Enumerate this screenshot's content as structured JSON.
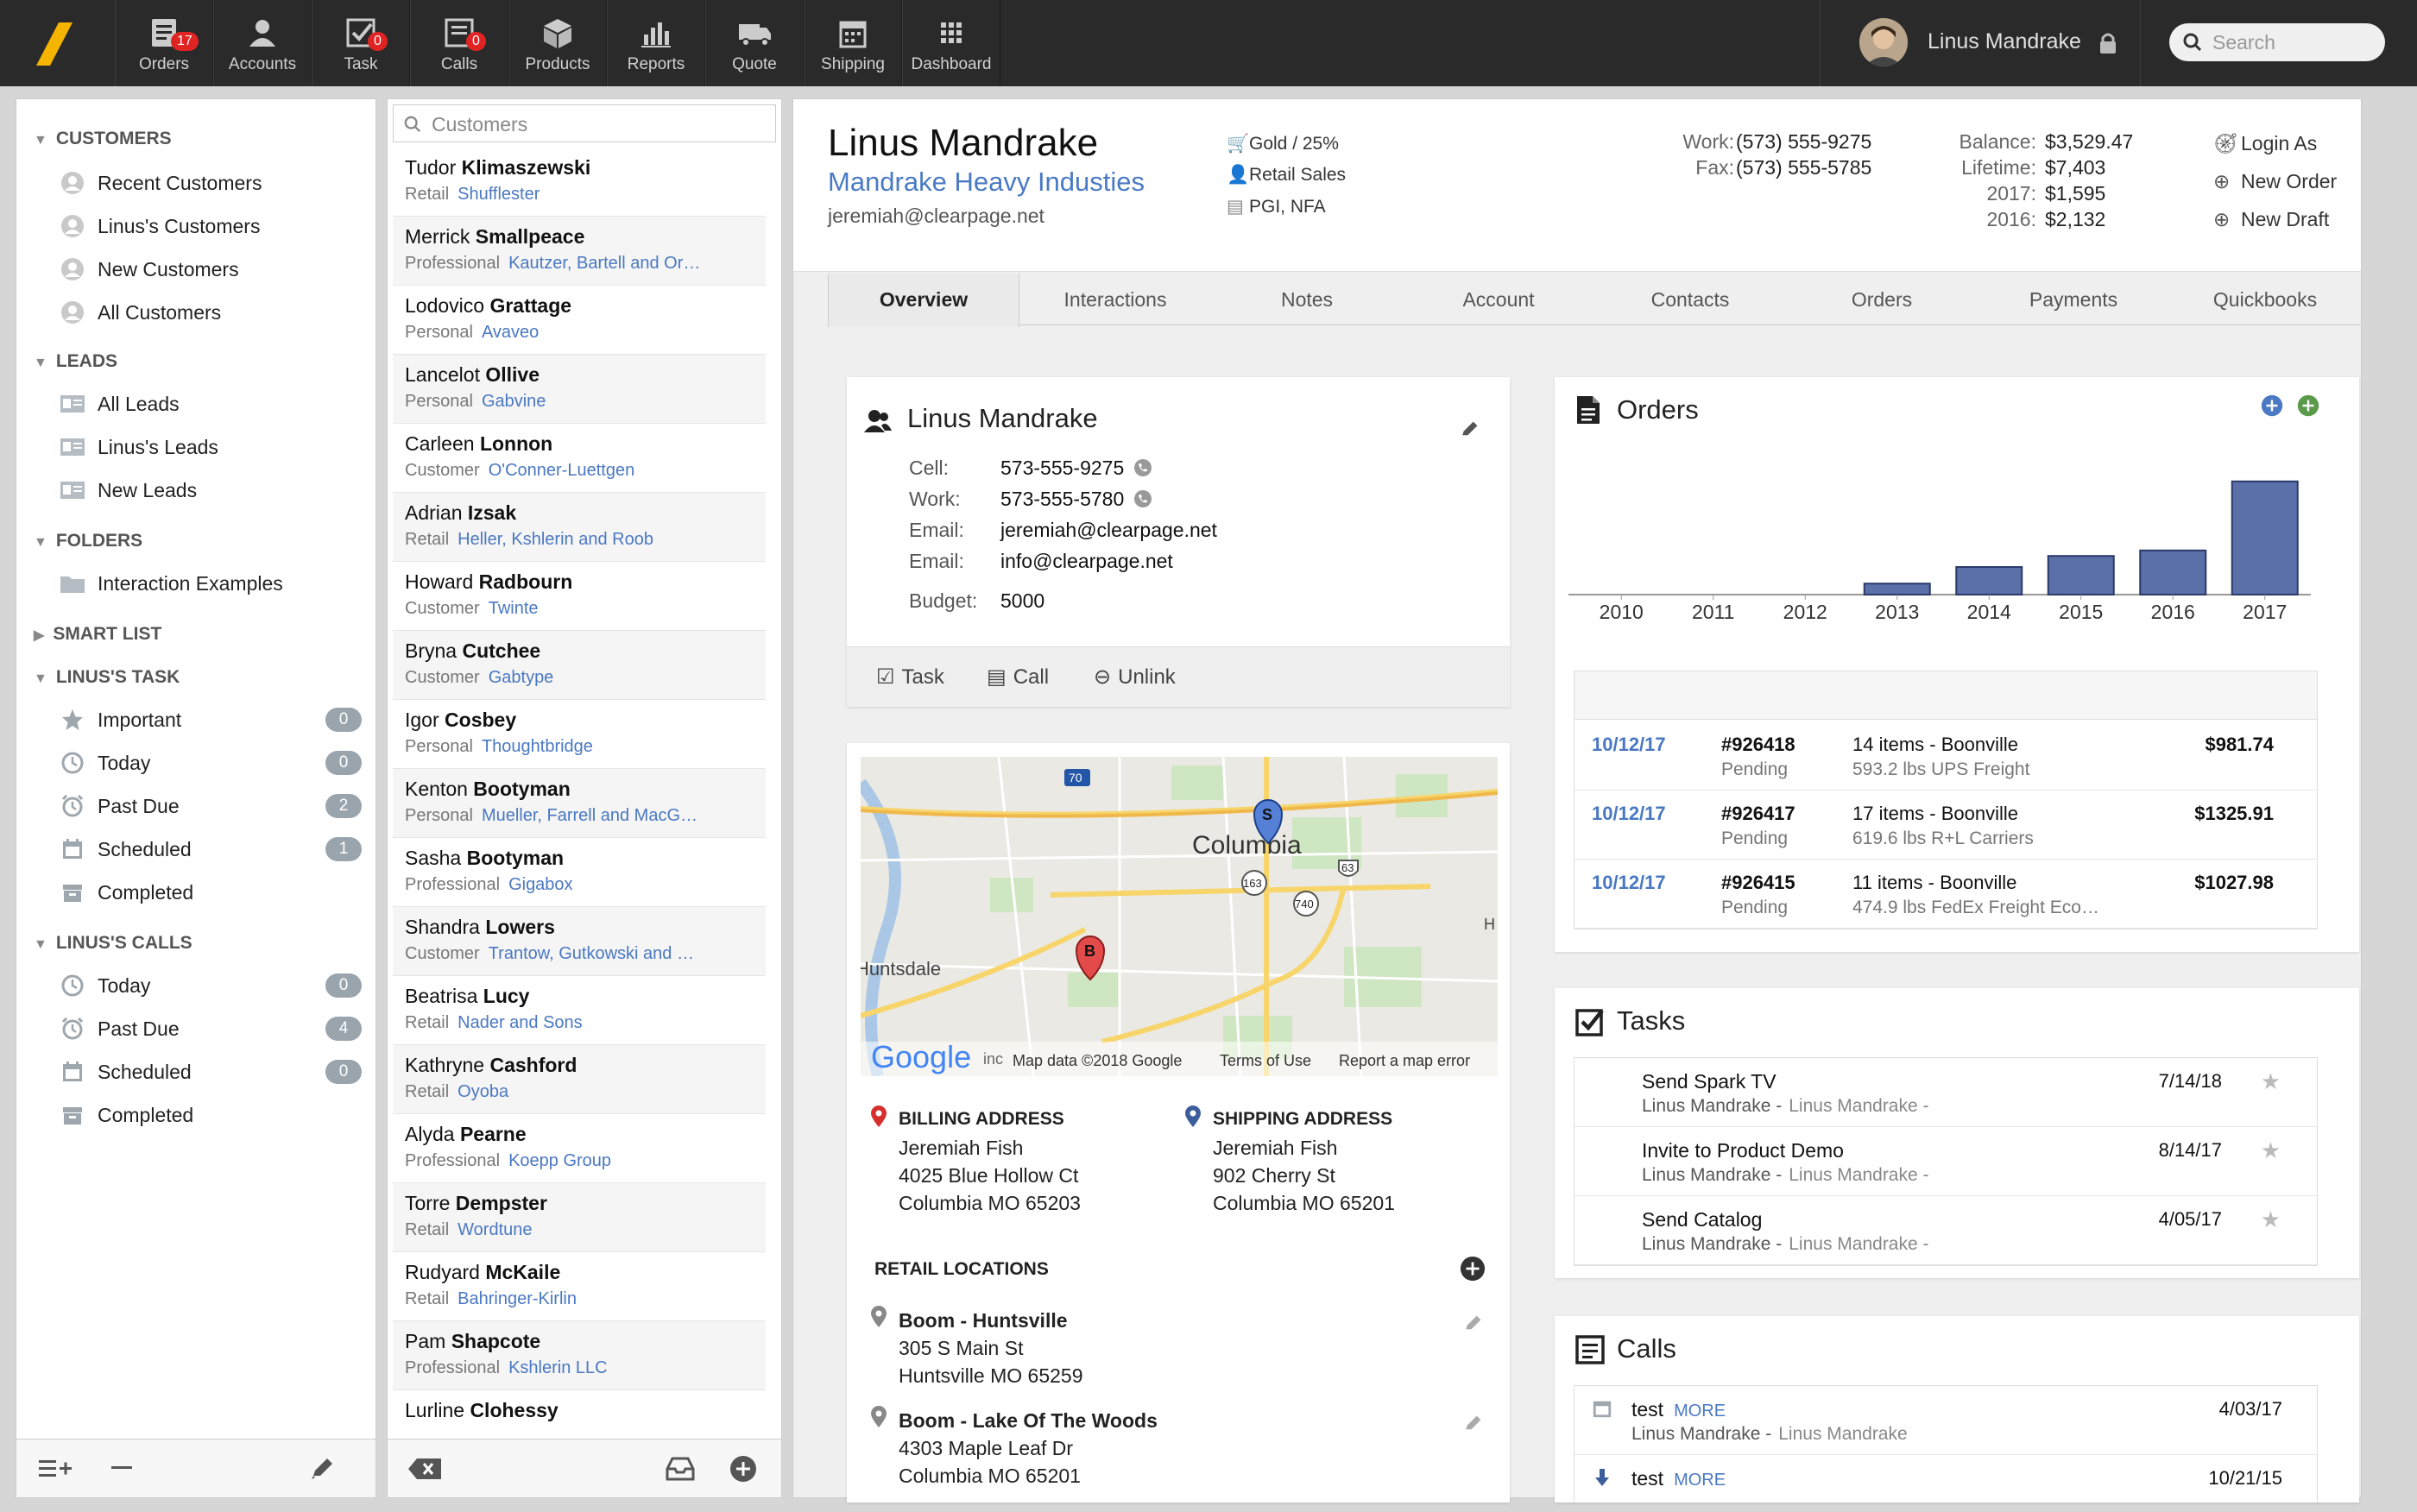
{
  "topnav": {
    "items": [
      {
        "label": "Orders",
        "badge": "17",
        "icon": "orders-icon"
      },
      {
        "label": "Accounts",
        "badge": "",
        "icon": "accounts-icon"
      },
      {
        "label": "Task",
        "badge": "0",
        "icon": "task-icon"
      },
      {
        "label": "Calls",
        "badge": "0",
        "icon": "calls-icon"
      },
      {
        "label": "Products",
        "badge": "",
        "icon": "products-icon"
      },
      {
        "label": "Reports",
        "badge": "",
        "icon": "reports-icon"
      },
      {
        "label": "Quote",
        "badge": "",
        "icon": "quote-icon"
      },
      {
        "label": "Shipping",
        "badge": "",
        "icon": "shipping-icon"
      },
      {
        "label": "Dashboard",
        "badge": "",
        "icon": "dashboard-icon"
      }
    ],
    "user_name": "Linus Mandrake",
    "search_placeholder": "Search"
  },
  "sidebar": {
    "customers_header": "CUSTOMERS",
    "customers": [
      "Recent Customers",
      "Linus's Customers",
      "New Customers",
      "All Customers"
    ],
    "leads_header": "LEADS",
    "leads": [
      "All Leads",
      "Linus's Leads",
      "New Leads"
    ],
    "folders_header": "FOLDERS",
    "folders": [
      "Interaction Examples"
    ],
    "smartlist_header": "SMART LIST",
    "task_header": "LINUS'S TASK",
    "tasks": [
      {
        "label": "Important",
        "count": "0"
      },
      {
        "label": "Today",
        "count": "0"
      },
      {
        "label": "Past Due",
        "count": "2"
      },
      {
        "label": "Scheduled",
        "count": "1"
      },
      {
        "label": "Completed",
        "count": ""
      }
    ],
    "calls_header": "LINUS'S CALLS",
    "calls": [
      {
        "label": "Today",
        "count": "0"
      },
      {
        "label": "Past Due",
        "count": "4"
      },
      {
        "label": "Scheduled",
        "count": "0"
      },
      {
        "label": "Completed",
        "count": ""
      }
    ]
  },
  "customer_list": {
    "search_placeholder": "Customers",
    "rows": [
      {
        "first": "Tudor",
        "last": "Klimaszewski",
        "type": "Retail",
        "company": "Shufflester"
      },
      {
        "first": "Merrick",
        "last": "Smallpeace",
        "type": "Professional",
        "company": "Kautzer, Bartell and Or…"
      },
      {
        "first": "Lodovico",
        "last": "Grattage",
        "type": "Personal",
        "company": "Avaveo"
      },
      {
        "first": "Lancelot",
        "last": "Ollive",
        "type": "Personal",
        "company": "Gabvine"
      },
      {
        "first": "Carleen",
        "last": "Lonnon",
        "type": "Customer",
        "company": "O'Conner-Luettgen"
      },
      {
        "first": "Adrian",
        "last": "Izsak",
        "type": "Retail",
        "company": "Heller, Kshlerin and Roob"
      },
      {
        "first": "Howard",
        "last": "Radbourn",
        "type": "Customer",
        "company": "Twinte"
      },
      {
        "first": "Bryna",
        "last": "Cutchee",
        "type": "Customer",
        "company": "Gabtype"
      },
      {
        "first": "Igor",
        "last": "Cosbey",
        "type": "Personal",
        "company": "Thoughtbridge"
      },
      {
        "first": "Kenton",
        "last": "Bootyman",
        "type": "Personal",
        "company": "Mueller, Farrell and MacG…"
      },
      {
        "first": "Sasha",
        "last": "Bootyman",
        "type": "Professional",
        "company": "Gigabox"
      },
      {
        "first": "Shandra",
        "last": "Lowers",
        "type": "Customer",
        "company": "Trantow, Gutkowski and …"
      },
      {
        "first": "Beatrisa",
        "last": "Lucy",
        "type": "Retail",
        "company": "Nader and Sons"
      },
      {
        "first": "Kathryne",
        "last": "Cashford",
        "type": "Retail",
        "company": "Oyoba"
      },
      {
        "first": "Alyda",
        "last": "Pearne",
        "type": "Professional",
        "company": "Koepp Group"
      },
      {
        "first": "Torre",
        "last": "Dempster",
        "type": "Retail",
        "company": "Wordtune"
      },
      {
        "first": "Rudyard",
        "last": "McKaile",
        "type": "Retail",
        "company": "Bahringer-Kirlin"
      },
      {
        "first": "Pam",
        "last": "Shapcote",
        "type": "Professional",
        "company": "Kshlerin LLC"
      },
      {
        "first": "Lurline",
        "last": "Clohessy",
        "type": "",
        "company": ""
      }
    ]
  },
  "header": {
    "name": "Linus Mandrake",
    "company": "Mandrake Heavy Industies",
    "email": "jeremiah@clearpage.net",
    "tier": "Gold / 25%",
    "role": "Retail Sales",
    "codes": "PGI, NFA",
    "work_label": "Work:",
    "work_phone": "(573) 555-9275",
    "fax_label": "Fax:",
    "fax_phone": "(573) 555-5785",
    "balance_label": "Balance:",
    "balance": "$3,529.47",
    "lifetime_label": "Lifetime:",
    "lifetime": "$7,403",
    "y2017_label": "2017:",
    "y2017": "$1,595",
    "y2016_label": "2016:",
    "y2016": "$2,132",
    "actions": [
      "Login As",
      "New Order",
      "New Draft"
    ]
  },
  "tabs": [
    "Overview",
    "Interactions",
    "Notes",
    "Account",
    "Contacts",
    "Orders",
    "Payments",
    "Quickbooks"
  ],
  "contact_card": {
    "name": "Linus Mandrake",
    "cell_label": "Cell:",
    "cell": "573-555-9275",
    "work_label": "Work:",
    "work": "573-555-5780",
    "email_label": "Email:",
    "email1": "jeremiah@clearpage.net",
    "email2_label": "Email:",
    "email2": "info@clearpage.net",
    "budget_label": "Budget:",
    "budget": "5000",
    "actions": [
      "Task",
      "Call",
      "Unlink"
    ]
  },
  "map": {
    "city": "Columbia",
    "city2": "Huntsdale",
    "route70": "70",
    "route63": "63",
    "route163": "163",
    "route740": "740",
    "marker_s": "S",
    "marker_b": "B",
    "google": "Google",
    "inc": "inc",
    "attribution": "Map data ©2018 Google",
    "terms": "Terms of Use",
    "report": "Report a map error",
    "edge_h": "H"
  },
  "billing": {
    "header": "BILLING ADDRESS",
    "name": "Jeremiah Fish",
    "street": "4025 Blue Hollow Ct",
    "city": "Columbia MO 65203"
  },
  "shipping": {
    "header": "SHIPPING ADDRESS",
    "name": "Jeremiah Fish",
    "street": "902 Cherry St",
    "city": "Columbia MO 65201"
  },
  "retail": {
    "header": "RETAIL LOCATIONS",
    "locations": [
      {
        "name": "Boom - Huntsville",
        "street": "305 S Main St",
        "city": "Huntsville MO 65259"
      },
      {
        "name": "Boom - Lake Of The Woods",
        "street": "4303 Maple Leaf Dr",
        "city": "Columbia MO 65201"
      }
    ]
  },
  "orders": {
    "title": "Orders",
    "rows": [
      {
        "date": "10/12/17",
        "num": "#926418",
        "status": "Pending",
        "desc": "14 items - Boonville",
        "freight": "593.2 lbs UPS Freight",
        "amount": "$981.74"
      },
      {
        "date": "10/12/17",
        "num": "#926417",
        "status": "Pending",
        "desc": "17 items - Boonville",
        "freight": "619.6 lbs R+L Carriers",
        "amount": "$1325.91"
      },
      {
        "date": "10/12/17",
        "num": "#926415",
        "status": "Pending",
        "desc": "11 items - Boonville",
        "freight": "474.9 lbs FedEx Freight Eco…",
        "amount": "$1027.98"
      }
    ]
  },
  "chart_data": {
    "type": "bar",
    "categories": [
      "2010",
      "2011",
      "2012",
      "2013",
      "2014",
      "2015",
      "2016",
      "2017"
    ],
    "values": [
      0,
      0,
      0,
      8,
      20,
      28,
      32,
      82
    ],
    "ylim": [
      0,
      100
    ],
    "bar_color": "#5b6fa8"
  },
  "tasks": {
    "title": "Tasks",
    "rows": [
      {
        "title": "Send Spark TV",
        "owner": "Linus Mandrake -",
        "assignee": "Linus Mandrake -",
        "date": "7/14/18"
      },
      {
        "title": "Invite to Product Demo",
        "owner": "Linus Mandrake -",
        "assignee": "Linus Mandrake -",
        "date": "8/14/17"
      },
      {
        "title": "Send Catalog",
        "owner": "Linus Mandrake -",
        "assignee": "Linus Mandrake -",
        "date": "4/05/17"
      }
    ]
  },
  "calls": {
    "title": "Calls",
    "rows": [
      {
        "title": "test",
        "more": "MORE",
        "owner": "Linus Mandrake -",
        "assignee": "Linus Mandrake",
        "date": "4/03/17"
      },
      {
        "title": "test",
        "more": "MORE",
        "owner": "",
        "assignee": "",
        "date": "10/21/15"
      }
    ]
  },
  "colors": {
    "accent": "#4a78c2",
    "topbar": "#2a2a2a",
    "badge": "#e02424",
    "logo": "#f5b400"
  }
}
